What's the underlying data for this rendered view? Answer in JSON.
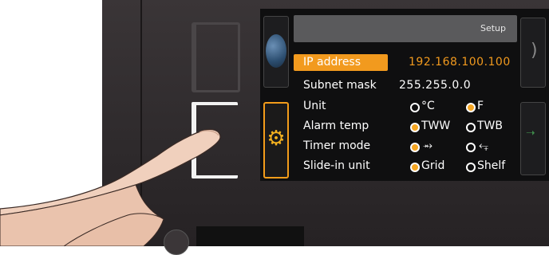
{
  "header": {
    "title": "Setup"
  },
  "network": {
    "ip_label": "IP address",
    "ip_value": "192.168.100.100",
    "subnet_label": "Subnet mask",
    "subnet_value": "255.255.0.0"
  },
  "settings": {
    "unit": {
      "label": "Unit",
      "options": [
        "°C",
        "F"
      ],
      "selected": "F"
    },
    "alarm_temp": {
      "label": "Alarm temp",
      "options": [
        "TWW",
        "TWB"
      ],
      "selected": "TWW"
    },
    "timer_mode": {
      "label": "Timer mode",
      "options": [
        "timer-up-icon",
        "timer-down-icon"
      ],
      "selected": "timer-up-icon"
    },
    "slide_in_unit": {
      "label": "Slide-in unit",
      "options": [
        "Grid",
        "Shelf"
      ],
      "selected": "Grid"
    }
  },
  "colors": {
    "accent": "#f29a1e",
    "screen_bg": "#0f0f10",
    "panel_bg": "#2e2a2c",
    "title_bar": "#5a5a5c"
  },
  "icons": {
    "left_top": "globe-icon",
    "left_bottom": "settings-gear-icon"
  }
}
